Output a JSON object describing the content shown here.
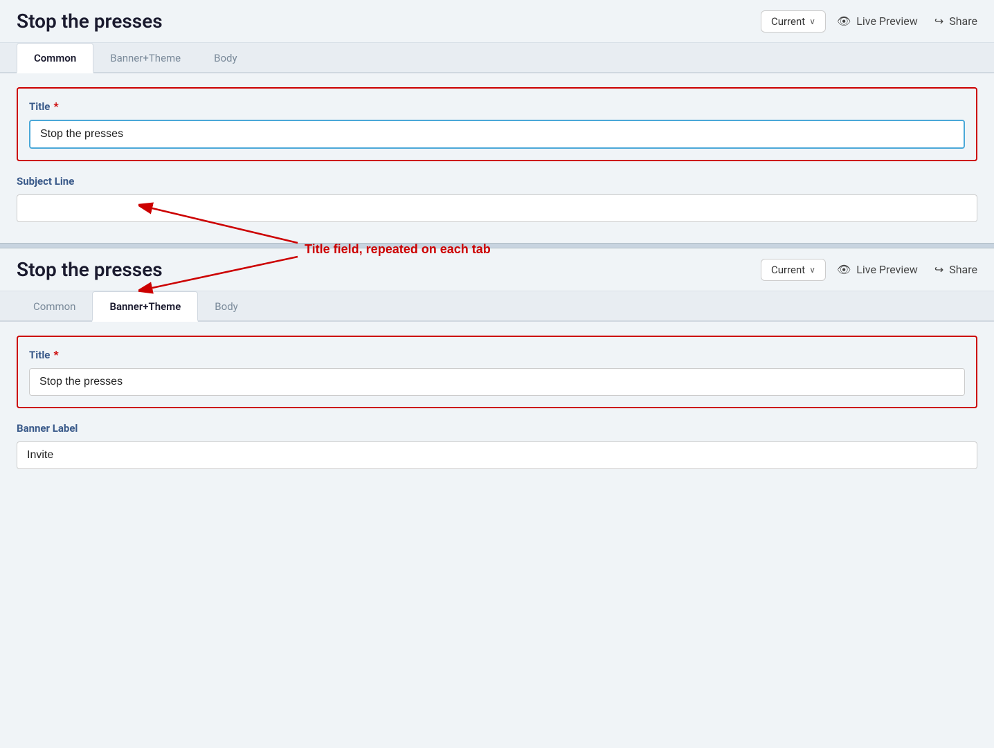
{
  "section1": {
    "title": "Stop the presses",
    "version_label": "Current",
    "live_preview_label": "Live Preview",
    "share_label": "Share",
    "tabs": [
      {
        "id": "common",
        "label": "Common",
        "active": true
      },
      {
        "id": "banner_theme",
        "label": "Banner+Theme",
        "active": false
      },
      {
        "id": "body",
        "label": "Body",
        "active": false
      }
    ],
    "title_field": {
      "label": "Title",
      "required": true,
      "value": "Stop the presses",
      "focused": true
    },
    "subject_line_field": {
      "label": "Subject Line",
      "required": false,
      "value": "",
      "placeholder": ""
    }
  },
  "annotation": {
    "text": "Title field, repeated on each tab"
  },
  "section2": {
    "title": "Stop the presses",
    "version_label": "Current",
    "live_preview_label": "Live Preview",
    "share_label": "Share",
    "tabs": [
      {
        "id": "common",
        "label": "Common",
        "active": false
      },
      {
        "id": "banner_theme",
        "label": "Banner+Theme",
        "active": true
      },
      {
        "id": "body",
        "label": "Body",
        "active": false
      }
    ],
    "title_field": {
      "label": "Title",
      "required": true,
      "value": "Stop the presses"
    },
    "banner_label_field": {
      "label": "Banner Label",
      "required": false,
      "value": "Invite"
    }
  },
  "icons": {
    "eye": "👁",
    "share": "↪",
    "chevron": "∨"
  }
}
